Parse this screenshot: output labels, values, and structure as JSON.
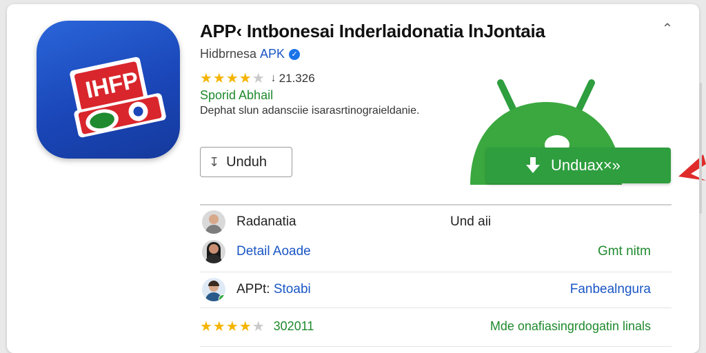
{
  "app": {
    "title": "APP‹ Intbonesai Inderlaidonatia lnJontaia",
    "developer": "Hidbrnesa",
    "apk_tag": "APK",
    "rating_count": "21.326",
    "category": "Sporid Abhail",
    "description": "Dephat slun adansciie isarasrtinograieldanie.",
    "stars": 4.5
  },
  "buttons": {
    "unduh_label": "Unduh",
    "green_unduh_label": "Unduax×»"
  },
  "details": {
    "rows": [
      {
        "label": "Radanatia",
        "right": "Und aii"
      },
      {
        "label": "Detail Aoade",
        "right": "Gmt nitm"
      },
      {
        "label_prefix": "APPt:",
        "label_blue": "Stoabi",
        "right": "Fanbealngura"
      },
      {
        "number": "302011",
        "right": "Mde onafiasingrdogatin linals"
      }
    ]
  },
  "colors": {
    "accent_green": "#2e9e3e",
    "link_blue": "#1a56c4",
    "star_yellow": "#f4b400",
    "icon_blue": "#1a46b8"
  }
}
